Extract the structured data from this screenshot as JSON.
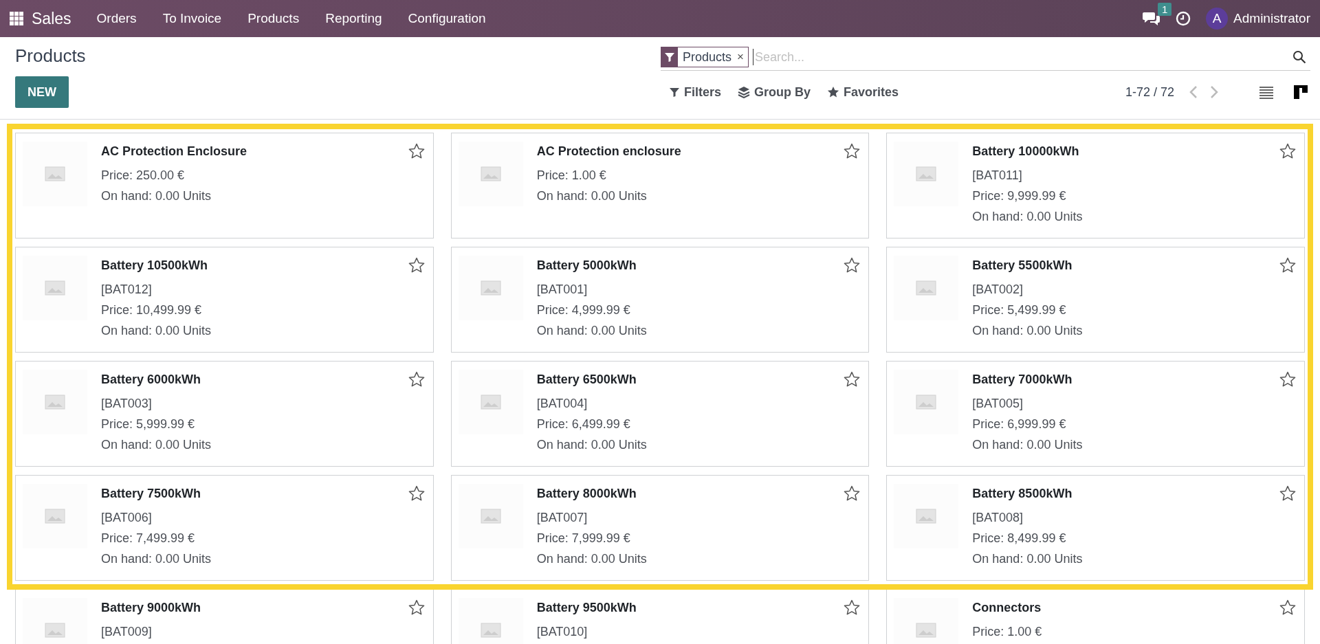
{
  "navbar": {
    "app": "Sales",
    "menu": [
      "Orders",
      "To Invoice",
      "Products",
      "Reporting",
      "Configuration"
    ],
    "messages_count": "1",
    "avatar_letter": "A",
    "user": "Administrator"
  },
  "control_panel": {
    "title": "Products",
    "new_button": "NEW",
    "facet": "Products",
    "facet_remove": "×",
    "search": {
      "placeholder": "Search..."
    },
    "filters": "Filters",
    "group_by": "Group By",
    "favorites": "Favorites",
    "pager": "1-72 / 72",
    "views": [
      {
        "kind": "list",
        "selected": false
      },
      {
        "kind": "kanban",
        "selected": true
      }
    ]
  },
  "cards": [
    {
      "name": "AC Protection Enclosure",
      "price": "Price: 250.00 €",
      "on_hand": "On hand: 0.00 Units",
      "favorite": false
    },
    {
      "name": "AC Protection enclosure",
      "price": "Price: 1.00 €",
      "on_hand": "On hand: 0.00 Units",
      "favorite": false
    },
    {
      "name": "Battery 10000kWh",
      "code": "[BAT011]",
      "price": "Price: 9,999.99 €",
      "on_hand": "On hand: 0.00 Units",
      "favorite": false
    },
    {
      "name": "Battery 10500kWh",
      "code": "[BAT012]",
      "price": "Price: 10,499.99 €",
      "on_hand": "On hand: 0.00 Units",
      "favorite": false
    },
    {
      "name": "Battery 5000kWh",
      "code": "[BAT001]",
      "price": "Price: 4,999.99 €",
      "on_hand": "On hand: 0.00 Units",
      "favorite": false
    },
    {
      "name": "Battery 5500kWh",
      "code": "[BAT002]",
      "price": "Price: 5,499.99 €",
      "on_hand": "On hand: 0.00 Units",
      "favorite": false
    },
    {
      "name": "Battery 6000kWh",
      "code": "[BAT003]",
      "price": "Price: 5,999.99 €",
      "on_hand": "On hand: 0.00 Units",
      "favorite": false
    },
    {
      "name": "Battery 6500kWh",
      "code": "[BAT004]",
      "price": "Price: 6,499.99 €",
      "on_hand": "On hand: 0.00 Units",
      "favorite": false
    },
    {
      "name": "Battery 7000kWh",
      "code": "[BAT005]",
      "price": "Price: 6,999.99 €",
      "on_hand": "On hand: 0.00 Units",
      "favorite": false
    },
    {
      "name": "Battery 7500kWh",
      "code": "[BAT006]",
      "price": "Price: 7,499.99 €",
      "on_hand": "On hand: 0.00 Units",
      "favorite": false
    },
    {
      "name": "Battery 8000kWh",
      "code": "[BAT007]",
      "price": "Price: 7,999.99 €",
      "on_hand": "On hand: 0.00 Units",
      "favorite": false
    },
    {
      "name": "Battery 8500kWh",
      "code": "[BAT008]",
      "price": "Price: 8,499.99 €",
      "on_hand": "On hand: 0.00 Units",
      "favorite": false
    },
    {
      "name": "Battery 9000kWh",
      "code": "[BAT009]",
      "favorite": false
    },
    {
      "name": "Battery 9500kWh",
      "code": "[BAT010]",
      "favorite": false
    },
    {
      "name": "Connectors",
      "price": "Price: 1.00 €",
      "favorite": false
    }
  ]
}
